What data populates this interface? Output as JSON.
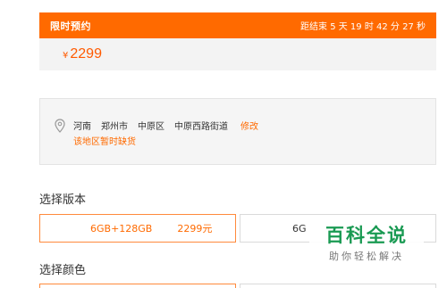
{
  "promo": {
    "title": "限时预约",
    "countdown": "距结束 5 天 19 时 42 分 27 秒",
    "currency": "¥",
    "price": "2299"
  },
  "address": {
    "province": "河南",
    "city": "郑州市",
    "district": "中原区",
    "street": "中原西路街道",
    "edit_label": "修改",
    "status": "该地区暂时缺货"
  },
  "version": {
    "label": "选择版本",
    "options": [
      {
        "spec": "6GB+128GB",
        "price": "2299元",
        "selected": true
      },
      {
        "spec": "6G",
        "price": "",
        "selected": false
      }
    ]
  },
  "color": {
    "label": "选择颜色"
  },
  "watermark": {
    "title": "百科全说",
    "subtitle": "助你轻松解决"
  },
  "colors": {
    "accent": "#ff6a00",
    "brand_green": "#1a9a53"
  }
}
